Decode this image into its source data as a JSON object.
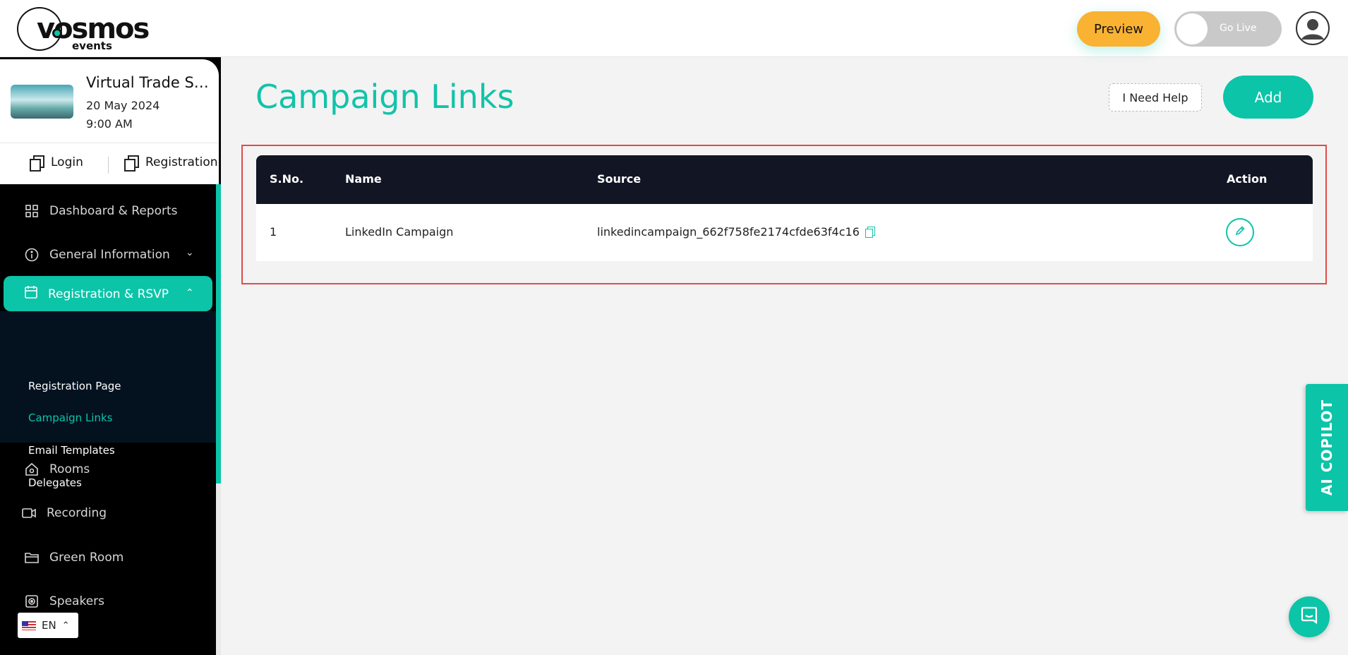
{
  "header": {
    "logo_text": "vosmos",
    "logo_sub": "events",
    "preview_label": "Preview",
    "golive_label": "Go Live"
  },
  "event": {
    "title": "Virtual Trade Show",
    "date": "20 May 2024",
    "time": "9:00 AM",
    "login_label": "Login",
    "registration_label": "Registration"
  },
  "sidebar": {
    "items": [
      {
        "label": "Dashboard & Reports",
        "icon": "grid-icon"
      },
      {
        "label": "General Information",
        "icon": "info-icon"
      },
      {
        "label": "Registration & RSVP",
        "icon": "calendar-icon"
      },
      {
        "label": "Rooms",
        "icon": "home-icon"
      },
      {
        "label": "Recording",
        "icon": "video-icon"
      },
      {
        "label": "Green Room",
        "icon": "folder-icon"
      },
      {
        "label": "Speakers",
        "icon": "speaker-icon"
      }
    ],
    "submenu": [
      "Registration Page",
      "Campaign Links",
      "Email Templates",
      "Delegates"
    ],
    "active_sub": "Campaign Links"
  },
  "language": {
    "code": "EN"
  },
  "main": {
    "title": "Campaign Links",
    "help_label": "I Need Help",
    "add_label": "Add",
    "table": {
      "columns": [
        "S.No.",
        "Name",
        "Source",
        "Action"
      ],
      "rows": [
        {
          "sno": "1",
          "name": "LinkedIn Campaign",
          "source": "linkedincampaign_662f758fe2174cfde63f4c16"
        }
      ]
    }
  },
  "copilot_label": "AI COPILOT",
  "colors": {
    "accent": "#0cc4a8",
    "preview": "#f9b232",
    "table_header": "#121624",
    "highlight": "#e04b4b"
  }
}
